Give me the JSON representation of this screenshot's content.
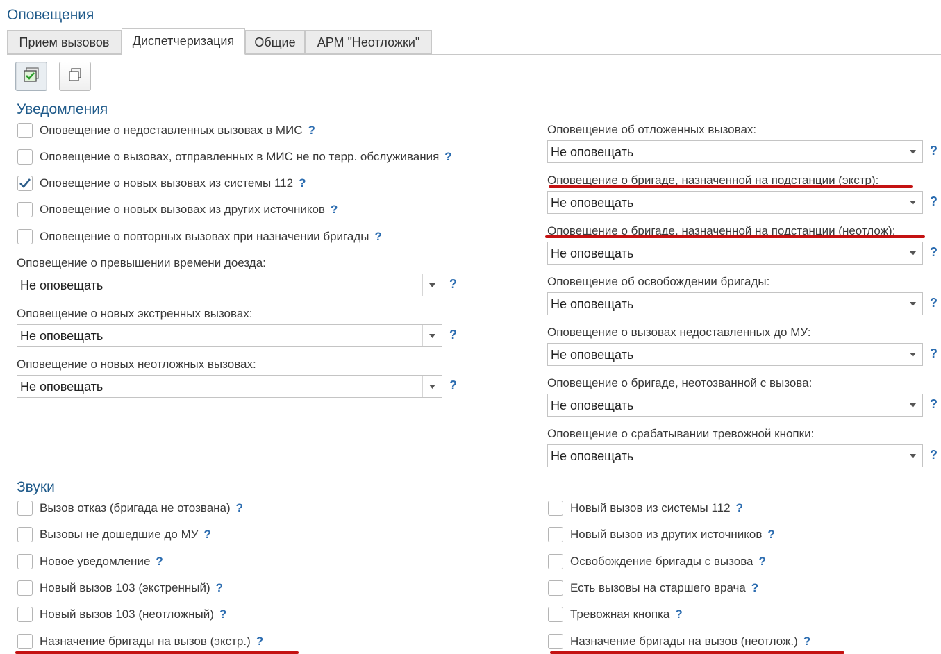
{
  "page_title": "Оповещения",
  "tabs": [
    {
      "label": "Прием вызовов"
    },
    {
      "label": "Диспетчеризация"
    },
    {
      "label": "Общие"
    },
    {
      "label": "АРМ \"Неотложки\""
    }
  ],
  "toolbar": {
    "icons": [
      "check-all-icon",
      "copy-icon"
    ]
  },
  "help_symbol": "?",
  "notifications": {
    "title": "Уведомления",
    "checkboxes": [
      {
        "label": "Оповещение о недоставленных вызовах в МИС",
        "checked": false
      },
      {
        "label": "Оповещение о вызовах, отправленных в МИС не по терр. обслуживания",
        "checked": false
      },
      {
        "label": "Оповещение о новых вызовах из системы 112",
        "checked": true
      },
      {
        "label": "Оповещение о новых вызовах из других источников",
        "checked": false
      },
      {
        "label": "Оповещение о повторных вызовах при назначении бригады",
        "checked": false
      }
    ],
    "left_fields": [
      {
        "label": "Оповещение о превышении времени доезда:",
        "value": "Не оповещать"
      },
      {
        "label": "Оповещение о новых экстренных вызовах:",
        "value": "Не оповещать"
      },
      {
        "label": "Оповещение о новых неотложных вызовах:",
        "value": "Не оповещать"
      }
    ],
    "right_fields": [
      {
        "label": "Оповещение об отложенных вызовах:",
        "value": "Не оповещать"
      },
      {
        "label": "Оповещение о бригаде, назначенной на подстанции (экстр):",
        "value": "Не оповещать"
      },
      {
        "label": "Оповещение о бригаде, назначенной на подстанции (неотлож):",
        "value": "Не оповещать"
      },
      {
        "label": "Оповещение об освобождении бригады:",
        "value": "Не оповещать"
      },
      {
        "label": "Оповещение о вызовах недоставленных до МУ:",
        "value": "Не оповещать"
      },
      {
        "label": "Оповещение о бригаде, неотозванной с вызова:",
        "value": "Не оповещать"
      },
      {
        "label": "Оповещение о срабатывании тревожной кнопки:",
        "value": "Не оповещать"
      }
    ]
  },
  "sounds": {
    "title": "Звуки",
    "left": [
      {
        "label": "Вызов отказ (бригада не отозвана)",
        "checked": false
      },
      {
        "label": "Вызовы не дошедшие до МУ",
        "checked": false
      },
      {
        "label": "Новое уведомление",
        "checked": false
      },
      {
        "label": "Новый вызов 103 (экстренный)",
        "checked": false
      },
      {
        "label": "Новый вызов 103 (неотложный)",
        "checked": false
      },
      {
        "label": "Назначение бригады на вызов (экстр.)",
        "checked": false
      }
    ],
    "right": [
      {
        "label": "Новый вызов из системы 112",
        "checked": false
      },
      {
        "label": "Новый вызов из других источников",
        "checked": false
      },
      {
        "label": "Освобождение бригады с вызова",
        "checked": false
      },
      {
        "label": "Есть вызовы на старшего врача",
        "checked": false
      },
      {
        "label": "Тревожная кнопка",
        "checked": false
      },
      {
        "label": "Назначение бригады на вызов (неотлож.)",
        "checked": false
      }
    ]
  },
  "colors": {
    "accent": "#1f5a8a",
    "help": "#2b6cb0",
    "highlight": "#c41212"
  }
}
